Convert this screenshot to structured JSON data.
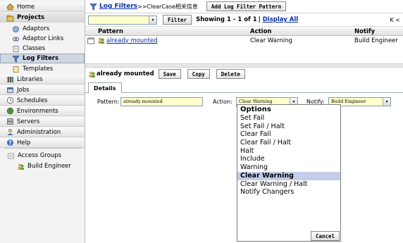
{
  "sidebar": {
    "items": [
      {
        "label": "Home",
        "icon": "house-icon"
      },
      {
        "label": "Projects",
        "icon": "folder-icon"
      },
      {
        "label": "Adaptors",
        "icon": "adaptor-icon"
      },
      {
        "label": "Adaptor Links",
        "icon": "link-icon"
      },
      {
        "label": "Classes",
        "icon": "class-icon"
      },
      {
        "label": "Log Filters",
        "icon": "funnel-icon"
      },
      {
        "label": "Templates",
        "icon": "template-icon"
      },
      {
        "label": "Libraries",
        "icon": "library-icon"
      },
      {
        "label": "Jobs",
        "icon": "jobs-icon"
      },
      {
        "label": "Schedules",
        "icon": "schedule-icon"
      },
      {
        "label": "Environments",
        "icon": "globe-icon"
      },
      {
        "label": "Servers",
        "icon": "server-icon"
      },
      {
        "label": "Administration",
        "icon": "admin-icon"
      },
      {
        "label": "Help",
        "icon": "help-icon"
      }
    ],
    "access_groups": {
      "label": "Access Groups",
      "child": "Build Engineer"
    }
  },
  "header": {
    "breadcrumb_link": "Log Filters",
    "breadcrumb_rest": ">>ClearCase相关信息",
    "add_button": "Add Log Filter Pattern"
  },
  "filterbar": {
    "filter_button": "Filter",
    "showing": "Showing 1 - 1 of 1",
    "display_all": "Display All",
    "pager": "K <"
  },
  "grid": {
    "columns": [
      "Pattern",
      "Action",
      "Notify"
    ],
    "rows": [
      {
        "pattern": "already mounted",
        "action": "Clear Warning",
        "notify": "Build Engineer"
      }
    ]
  },
  "detail": {
    "title": "already mounted",
    "save": "Save",
    "copy": "Copy",
    "delete": "Delete",
    "tab": "Details",
    "pattern_label": "Pattern:",
    "pattern_value": "already mounted",
    "action_label": "Action:",
    "action_value": "Clear Warning",
    "notify_label": "Notify:",
    "notify_value": "Build Engineer"
  },
  "dropdown": {
    "header": "Options",
    "options": [
      "Set Fail",
      "Set Fail / Halt",
      "Clear Fail",
      "Clear Fail / Halt",
      "Halt",
      "Include",
      "Warning",
      "Clear Warning",
      "Clear Warning / Halt",
      "Notify Changers"
    ],
    "selected": "Clear Warning",
    "cancel": "Cancel"
  },
  "colors": {
    "link": "#0b2fa0",
    "selected_option": "#c4cde9",
    "input_bg": "#ffffcc"
  }
}
